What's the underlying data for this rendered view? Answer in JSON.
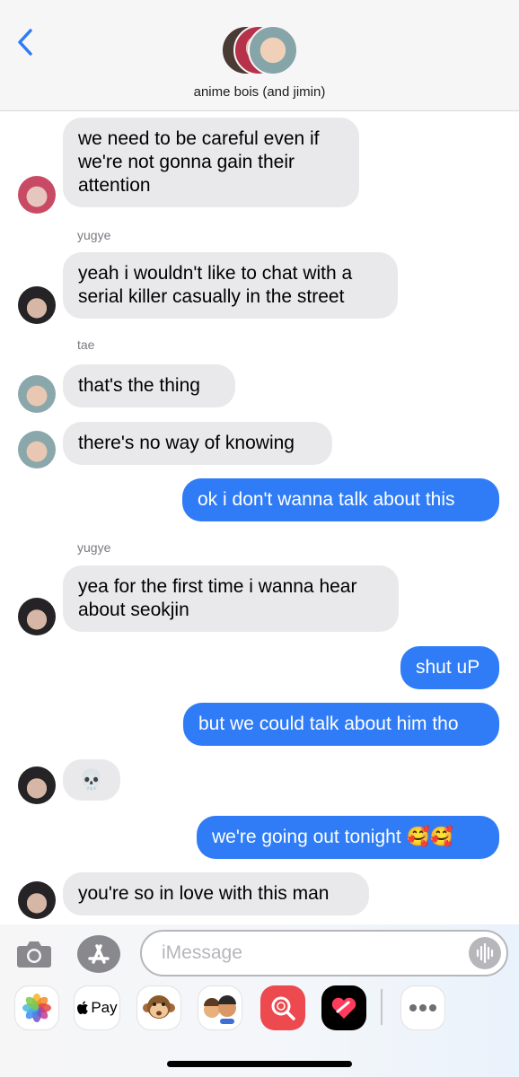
{
  "header": {
    "group_name": "anime bois (and jimin)"
  },
  "messages": [
    {
      "kind": "in",
      "text": "we need to be careful even if\nwe're not gonna gain their\nattention"
    },
    {
      "kind": "sender",
      "text": "yugye"
    },
    {
      "kind": "in",
      "text": "yeah i wouldn't like to chat with a\nserial killer casually in the street"
    },
    {
      "kind": "sender",
      "text": "tae"
    },
    {
      "kind": "in",
      "text": "that's the thing"
    },
    {
      "kind": "in",
      "text": "there's no way of knowing"
    },
    {
      "kind": "out",
      "text": "ok i don't wanna talk about this"
    },
    {
      "kind": "sender",
      "text": "yugye"
    },
    {
      "kind": "in",
      "text": "yea for the first time i wanna hear\nabout seokjin"
    },
    {
      "kind": "out",
      "text": "shut uP"
    },
    {
      "kind": "out",
      "text": "but we could talk about him tho"
    },
    {
      "kind": "in",
      "text": "💀"
    },
    {
      "kind": "out",
      "text": "we're going out tonight 🥰🥰"
    },
    {
      "kind": "in",
      "text": "you're so in love with this man"
    }
  ],
  "composer": {
    "placeholder": "iMessage"
  },
  "app_drawer": {
    "apple_pay_label": "Pay"
  },
  "colors": {
    "outgoing_bubble": "#2f7cf6",
    "incoming_bubble": "#e9e9eb",
    "accent": "#2f7cf6"
  },
  "icons": [
    "back-chevron-icon",
    "camera-icon",
    "app-store-icon",
    "audio-waveform-icon",
    "photos-icon",
    "apple-pay-icon",
    "monkey-animoji-icon",
    "memoji-icon",
    "image-search-icon",
    "digital-touch-icon",
    "more-icon",
    "skull-emoji"
  ]
}
